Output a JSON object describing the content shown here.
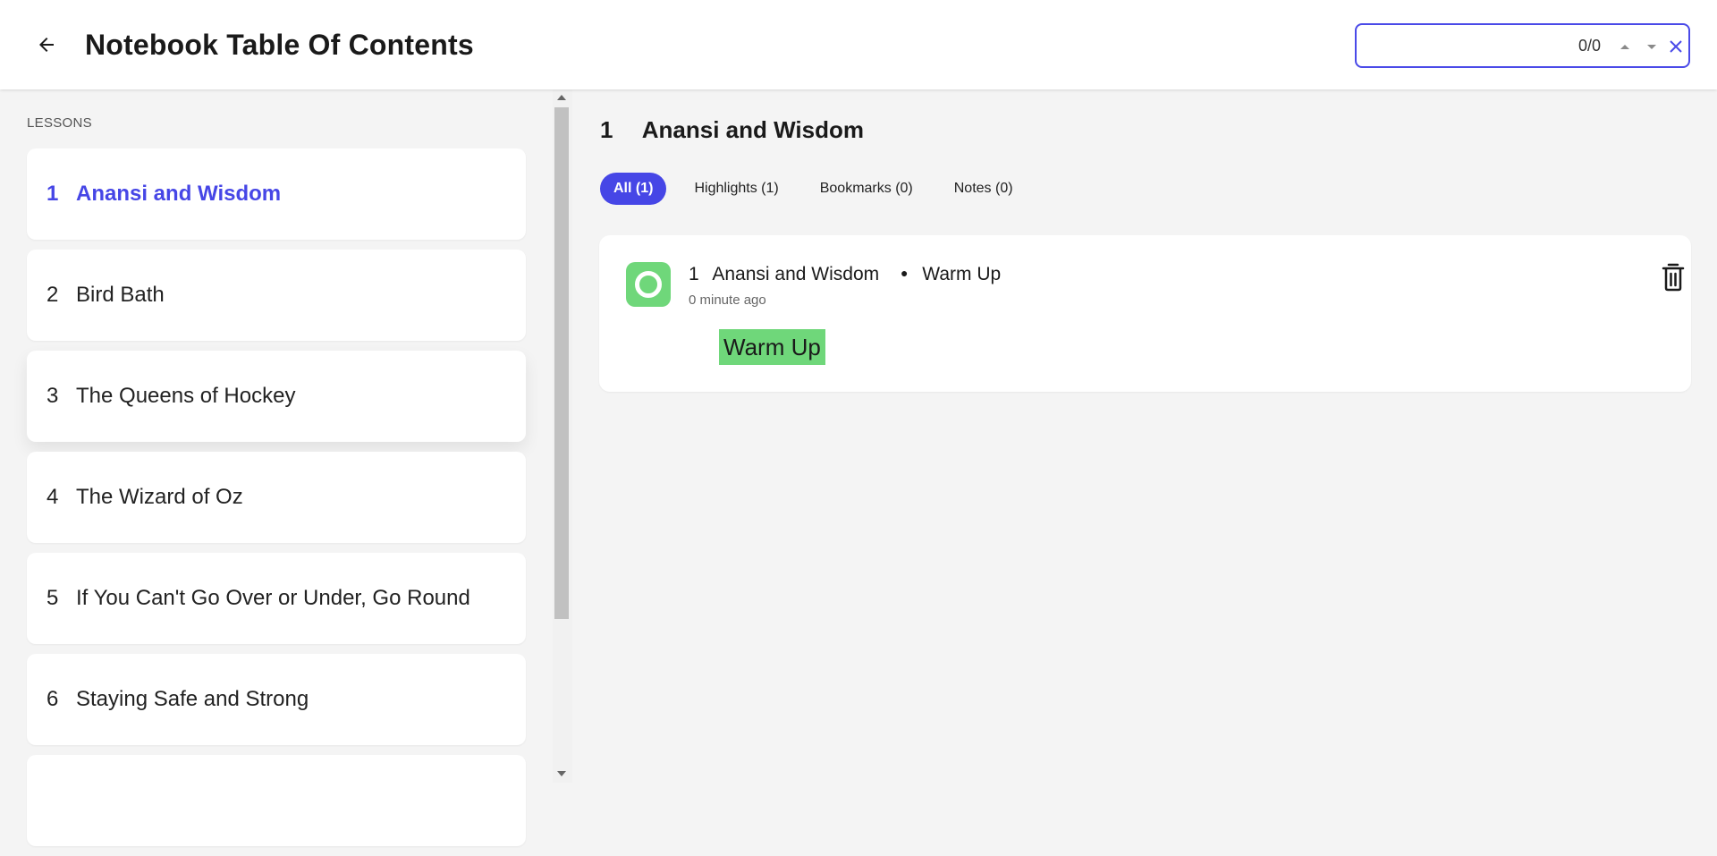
{
  "header": {
    "title": "Notebook Table Of Contents",
    "back_icon": "arrow-left-icon",
    "search": {
      "value": "",
      "placeholder": "",
      "count": "0/0"
    }
  },
  "sidebar": {
    "heading": "LESSONS",
    "lessons": [
      {
        "num": "1",
        "label": "Anansi and Wisdom"
      },
      {
        "num": "2",
        "label": "Bird Bath"
      },
      {
        "num": "3",
        "label": "The Queens of Hockey"
      },
      {
        "num": "4",
        "label": "The Wizard of Oz"
      },
      {
        "num": "5",
        "label": "If You Can't Go Over or Under, Go Round"
      },
      {
        "num": "6",
        "label": "Staying Safe and Strong"
      },
      {
        "num": "",
        "label": ""
      }
    ]
  },
  "main": {
    "heading_num": "1",
    "heading_title": "Anansi and Wisdom",
    "tabs": [
      {
        "label": "All (1)"
      },
      {
        "label": "Highlights (1)"
      },
      {
        "label": "Bookmarks (0)"
      },
      {
        "label": "Notes (0)"
      }
    ],
    "entry": {
      "lesson_num": "1",
      "lesson_title": "Anansi and Wisdom",
      "section": "Warm Up",
      "time": "0 minute ago",
      "highlight_text": "Warm Up"
    }
  },
  "colors": {
    "accent": "#4646e6",
    "highlight_green": "#6fd77a",
    "background": "#f4f4f4"
  }
}
